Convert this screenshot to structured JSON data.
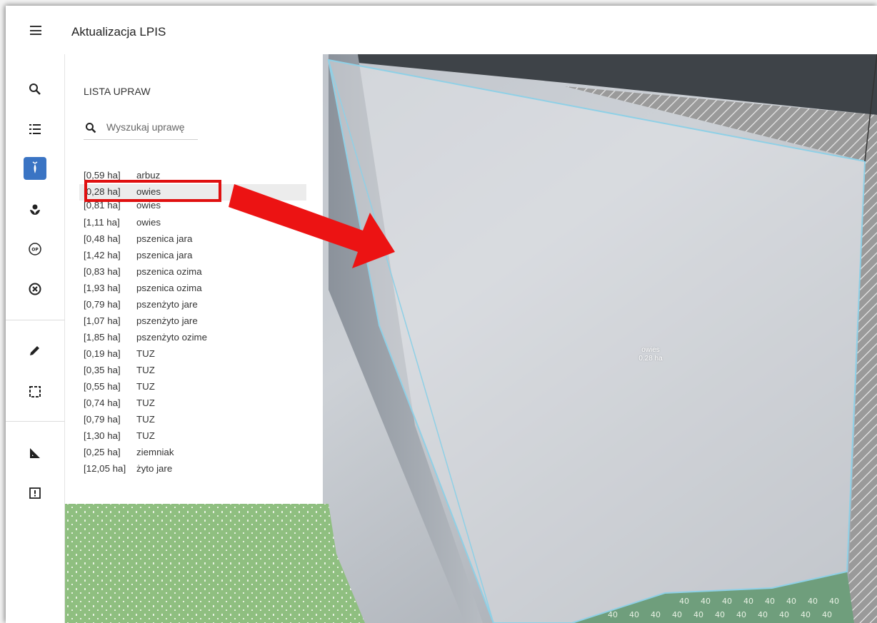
{
  "header": {
    "title": "Aktualizacja LPIS"
  },
  "rail": {
    "items": [
      {
        "icon": "search-icon",
        "active": false
      },
      {
        "icon": "list-icon",
        "active": false
      },
      {
        "icon": "crop-icon",
        "active": true
      },
      {
        "icon": "plant-icon",
        "active": false
      },
      {
        "icon": "op-icon",
        "active": false,
        "text": "OP"
      },
      {
        "icon": "cancel-circle-icon",
        "active": false
      },
      {
        "icon": "pencil-icon",
        "active": false
      },
      {
        "icon": "select-area-icon",
        "active": false
      },
      {
        "icon": "ruler-icon",
        "active": false
      },
      {
        "icon": "alert-icon",
        "active": false
      }
    ]
  },
  "panel": {
    "title": "LISTA UPRAW",
    "search_placeholder": "Wyszukaj uprawę"
  },
  "crops": [
    {
      "area": "[0,59 ha]",
      "name": "arbuz"
    },
    {
      "area": "[0,28 ha]",
      "name": "owies",
      "highlighted": true
    },
    {
      "area": "[0,81 ha]",
      "name": "owies"
    },
    {
      "area": "[1,11 ha]",
      "name": "owies"
    },
    {
      "area": "[0,48 ha]",
      "name": "pszenica jara"
    },
    {
      "area": "[1,42 ha]",
      "name": "pszenica jara"
    },
    {
      "area": "[0,83 ha]",
      "name": "pszenica ozima"
    },
    {
      "area": "[1,93 ha]",
      "name": "pszenica ozima"
    },
    {
      "area": "[0,79 ha]",
      "name": "pszenżyto jare"
    },
    {
      "area": "[1,07 ha]",
      "name": "pszenżyto jare"
    },
    {
      "area": "[1,85 ha]",
      "name": "pszenżyto ozime"
    },
    {
      "area": "[0,19 ha]",
      "name": "TUZ"
    },
    {
      "area": "[0,35 ha]",
      "name": "TUZ"
    },
    {
      "area": "[0,55 ha]",
      "name": "TUZ"
    },
    {
      "area": "[0,74 ha]",
      "name": "TUZ"
    },
    {
      "area": "[0,79 ha]",
      "name": "TUZ"
    },
    {
      "area": "[1,30 ha]",
      "name": "TUZ"
    },
    {
      "area": "[0,25 ha]",
      "name": "ziemniak"
    },
    {
      "area": "[12,05 ha]",
      "name": "żyto jare"
    }
  ],
  "map": {
    "parcel_label": {
      "crop": "owies",
      "area": "0.28 ha"
    },
    "hatch_marker": "40"
  },
  "colors": {
    "accent": "#3a74c4",
    "annotation": "#e01010",
    "parcel_outline": "#8fd0e6",
    "green_zone": "#8bb87a"
  }
}
